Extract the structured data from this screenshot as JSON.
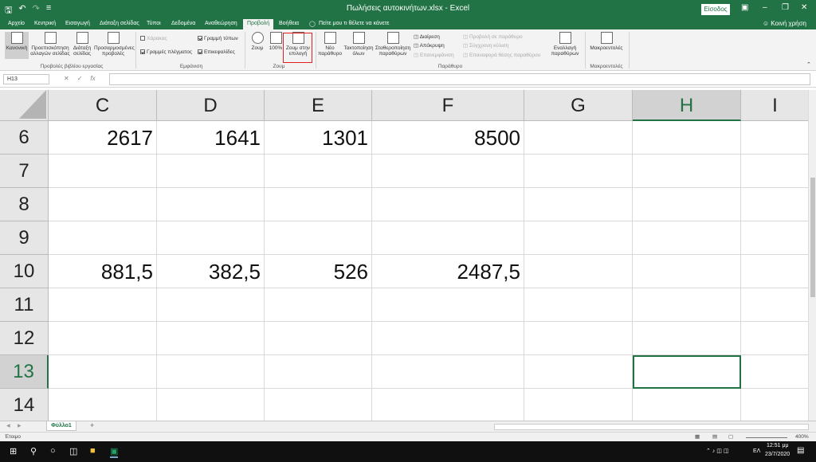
{
  "titlebar": {
    "title": "Πωλήσεις αυτοκινήτων.xlsx  -  Excel",
    "signin": "Είσοδος",
    "qat": [
      "save-icon",
      "undo-icon",
      "redo-icon",
      "customize-icon"
    ]
  },
  "menu": {
    "tabs": [
      "Αρχείο",
      "Κεντρική",
      "Εισαγωγή",
      "Διάταξη σελίδας",
      "Τύποι",
      "Δεδομένα",
      "Αναθεώρηση",
      "Προβολή",
      "Βοήθεια"
    ],
    "active": "Προβολή",
    "tellme": "Πείτε μου τι θέλετε να κάνετε",
    "share": "Κοινή χρήση"
  },
  "ribbon": {
    "views": {
      "normal": "Κανονική",
      "page_break": "Προεπισκόπηση αλλαγών σελίδας",
      "page_layout": "Διάταξη σελίδας",
      "custom": "Προσαρμοσμένες προβολές",
      "group": "Προβολές βιβλίου εργασίας"
    },
    "show": {
      "ruler": "Χάρακας",
      "formula_bar": "Γραμμή τύπων",
      "gridlines": "Γραμμές πλέγματος",
      "headings": "Επικεφαλίδες",
      "group": "Εμφάνιση"
    },
    "zoom": {
      "zoom": "Ζουμ",
      "hundred": "100%",
      "zoom_sel": "Ζουμ στην επιλογή",
      "group": "Ζουμ"
    },
    "window": {
      "new": "Νέο παράθυρο",
      "arrange": "Τακτοποίηση όλων",
      "freeze": "Σταθεροποίηση παραθύρων",
      "split": "Διαίρεση",
      "hide": "Απόκρυψη",
      "unhide": "Επανεμφάνιση",
      "side": "Προβολή σε παράθυρο",
      "sync": "Σύγχρονη κύλιση",
      "reset": "Επαναφορά θέσης παραθύρου",
      "switch": "Εναλλαγή παραθύρων",
      "group": "Παράθυρο"
    },
    "macros": {
      "macros": "Μακροεντολές",
      "group": "Μακροεντολές"
    }
  },
  "formula_bar": {
    "name_box": "H13",
    "value": ""
  },
  "sheet": {
    "columns": [
      "C",
      "D",
      "E",
      "F",
      "G",
      "H",
      "I"
    ],
    "selected_column": "H",
    "rows": [
      {
        "num": "6",
        "values": [
          "2617",
          "1641",
          "1301",
          "8500",
          "",
          "",
          ""
        ]
      },
      {
        "num": "7",
        "values": [
          "",
          "",
          "",
          "",
          "",
          "",
          ""
        ]
      },
      {
        "num": "8",
        "values": [
          "",
          "",
          "",
          "",
          "",
          "",
          ""
        ]
      },
      {
        "num": "9",
        "values": [
          "",
          "",
          "",
          "",
          "",
          "",
          ""
        ]
      },
      {
        "num": "10",
        "values": [
          "881,5",
          "382,5",
          "526",
          "2487,5",
          "",
          "",
          ""
        ]
      },
      {
        "num": "11",
        "values": [
          "",
          "",
          "",
          "",
          "",
          "",
          ""
        ]
      },
      {
        "num": "12",
        "values": [
          "",
          "",
          "",
          "",
          "",
          "",
          ""
        ]
      },
      {
        "num": "13",
        "values": [
          "",
          "",
          "",
          "",
          "",
          "",
          ""
        ]
      },
      {
        "num": "14",
        "values": [
          "",
          "",
          "",
          "",
          "",
          "",
          ""
        ]
      }
    ],
    "selected_row": "13",
    "active_cell": "H13"
  },
  "sheet_tabs": {
    "tabs": [
      "Φύλλο1"
    ],
    "add": "+"
  },
  "status": {
    "ready": "Έτοιμο",
    "zoom": "400%"
  },
  "taskbar": {
    "lang": "ΕΛ",
    "time": "12:51 μμ",
    "date": "23/7/2020"
  }
}
